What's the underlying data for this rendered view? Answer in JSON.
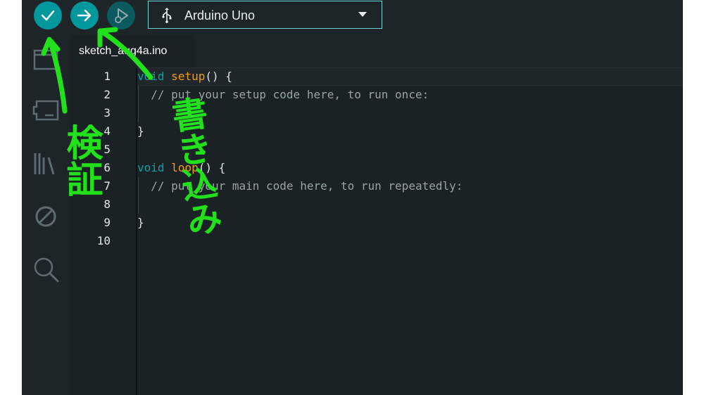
{
  "toolbar": {
    "verify_icon": "check-icon",
    "upload_icon": "arrow-right-icon",
    "debug_icon": "debug-play-icon"
  },
  "board_selector": {
    "icon": "usb-icon",
    "label": "Arduino Uno",
    "dropdown_icon": "chevron-down-icon"
  },
  "sidebar": {
    "items": [
      {
        "name": "sketchbook",
        "icon": "folder-icon"
      },
      {
        "name": "boards-manager",
        "icon": "board-icon"
      },
      {
        "name": "library-manager",
        "icon": "library-icon"
      },
      {
        "name": "debug",
        "icon": "no-entry-icon"
      },
      {
        "name": "search",
        "icon": "search-icon"
      }
    ]
  },
  "editor": {
    "tab_label": "sketch_aug4a.ino",
    "line_numbers": [
      "1",
      "2",
      "3",
      "4",
      "5",
      "6",
      "7",
      "8",
      "9",
      "10"
    ],
    "lines": [
      [
        {
          "t": "kw",
          "s": "void"
        },
        {
          "t": "txt",
          "s": " "
        },
        {
          "t": "fn",
          "s": "setup"
        },
        {
          "t": "txt",
          "s": "() {"
        }
      ],
      [
        {
          "t": "txt",
          "s": "  "
        },
        {
          "t": "cm",
          "s": "// put your setup code here, to run once:"
        }
      ],
      [],
      [
        {
          "t": "txt",
          "s": "}"
        }
      ],
      [],
      [
        {
          "t": "kw",
          "s": "void"
        },
        {
          "t": "txt",
          "s": " "
        },
        {
          "t": "fn",
          "s": "loop"
        },
        {
          "t": "txt",
          "s": "() {"
        }
      ],
      [
        {
          "t": "txt",
          "s": "  "
        },
        {
          "t": "cm",
          "s": "// put your main code here, to run repeatedly:"
        }
      ],
      [],
      [
        {
          "t": "txt",
          "s": "}"
        }
      ],
      []
    ]
  },
  "annotations": {
    "verify_note": "検証",
    "upload_note": "書き込み",
    "color": "#22e01b"
  },
  "colors": {
    "accent": "#00979d",
    "keyword": "#0ca1a6",
    "function": "#f39c12",
    "comment": "#95a5a6"
  }
}
